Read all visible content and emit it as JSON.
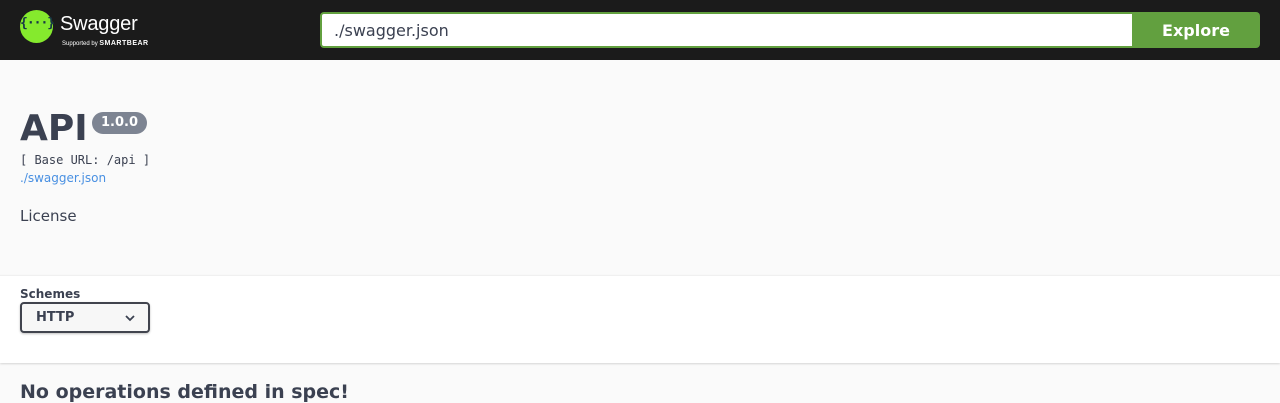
{
  "topbar": {
    "logo": {
      "glyph": "{···}",
      "name": "Swagger",
      "sub_small": "Supported by",
      "sub_brand": "SMARTBEAR",
      "brand_color": "#85ea2d"
    },
    "url_input": {
      "value": "./swagger.json",
      "accent": "#62a03f"
    },
    "explore_label": "Explore"
  },
  "info": {
    "title": "API",
    "version": "1.0.0",
    "base_url": "[ Base URL: /api ]",
    "spec_link": "./swagger.json",
    "license": "License"
  },
  "schemes": {
    "label": "Schemes",
    "selected": "HTTP",
    "icon": "chevron-down-icon"
  },
  "operations": {
    "empty_message": "No operations defined in spec!"
  }
}
